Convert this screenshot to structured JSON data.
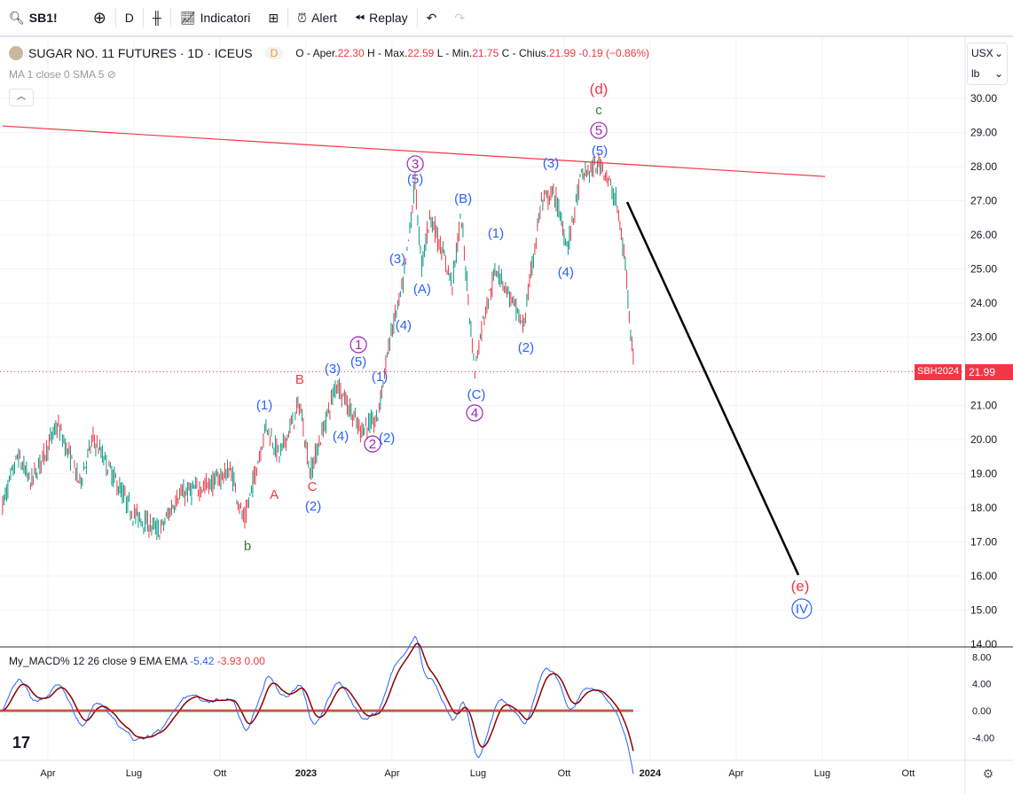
{
  "toolbar": {
    "symbol": "SB1!",
    "interval": "D",
    "indicators": "Indicatori",
    "alert": "Alert",
    "replay": "Replay"
  },
  "legend": {
    "title": "SUGAR NO. 11 FUTURES · 1D · ICEUS",
    "badge": "D",
    "o_label": "O - Aper.",
    "o": "22.30",
    "h_label": "H - Max.",
    "h": "22.59",
    "l_label": "L - Min.",
    "l": "21.75",
    "c_label": "C - Chius.",
    "c": "21.99",
    "chg": "-0.19 (−0.86%)"
  },
  "ma_legend": "MA 1 close 0 SMA 5",
  "macd_legend": {
    "name": "My_MACD% 12 26 close 9 EMA EMA",
    "v1": "-5.42",
    "v2": "-3.93",
    "v3": "0.00"
  },
  "units": {
    "currency": "USX",
    "unit": "lb"
  },
  "price_tag": {
    "symbol": "SBH2024",
    "value": "21.99"
  },
  "colors": {
    "up": "#089981",
    "down": "#f23645",
    "blue": "#2962ff",
    "purple": "#9c27b0",
    "green": "#2e7d32",
    "red": "#f23645"
  },
  "chart_data": {
    "type": "ohlc",
    "x_unit": "months since Jan 2022",
    "ylim": [
      14,
      30
    ],
    "yticks": [
      "30.00",
      "29.00",
      "28.00",
      "27.00",
      "26.00",
      "25.00",
      "24.00",
      "23.00",
      "22.00",
      "21.00",
      "20.00",
      "19.00",
      "18.00",
      "17.00",
      "16.00",
      "15.00",
      "14.00"
    ],
    "xticks": [
      {
        "m": 3,
        "label": "Apr"
      },
      {
        "m": 6,
        "label": "Lug"
      },
      {
        "m": 9,
        "label": "Ott"
      },
      {
        "m": 12,
        "label": "2023"
      },
      {
        "m": 15,
        "label": "Apr"
      },
      {
        "m": 18,
        "label": "Lug"
      },
      {
        "m": 21,
        "label": "Ott"
      },
      {
        "m": 24,
        "label": "2024"
      },
      {
        "m": 27,
        "label": "Apr"
      },
      {
        "m": 30,
        "label": "Lug"
      },
      {
        "m": 33,
        "label": "Ott"
      }
    ],
    "price_path": [
      [
        1.42,
        18.08
      ],
      [
        1.95,
        19.51
      ],
      [
        2.41,
        18.73
      ],
      [
        3.34,
        20.42
      ],
      [
        4.11,
        18.73
      ],
      [
        4.58,
        20.03
      ],
      [
        5.97,
        17.82
      ],
      [
        6.9,
        17.3
      ],
      [
        7.52,
        18.34
      ],
      [
        8.75,
        18.73
      ],
      [
        9.37,
        19.12
      ],
      [
        9.84,
        17.56
      ],
      [
        10.61,
        20.42
      ],
      [
        11.07,
        19.51
      ],
      [
        11.78,
        21.06
      ],
      [
        12.15,
        19.0
      ],
      [
        13.08,
        21.69
      ],
      [
        13.86,
        20.29
      ],
      [
        14.47,
        20.55
      ],
      [
        14.94,
        23.01
      ],
      [
        15.4,
        24.57
      ],
      [
        15.81,
        27.55
      ],
      [
        16.02,
        25.04
      ],
      [
        16.33,
        26.6
      ],
      [
        17.1,
        24.57
      ],
      [
        17.41,
        26.55
      ],
      [
        17.88,
        22.0
      ],
      [
        18.19,
        23.58
      ],
      [
        18.65,
        25.04
      ],
      [
        19.58,
        23.3
      ],
      [
        20.2,
        26.94
      ],
      [
        20.66,
        27.2
      ],
      [
        21.13,
        25.64
      ],
      [
        21.59,
        27.71
      ],
      [
        22.3,
        28.1
      ],
      [
        22.83,
        26.94
      ],
      [
        23.14,
        25.1
      ],
      [
        23.45,
        21.99
      ]
    ],
    "last_price": 21.99,
    "trendline": [
      [
        1.42,
        29.19
      ],
      [
        30.1,
        27.71
      ]
    ],
    "projection": [
      [
        23.2,
        26.96
      ],
      [
        29.17,
        16.03
      ]
    ],
    "macd": {
      "ylim": [
        -5.5,
        8.5
      ],
      "yticks": [
        "8.00",
        "4.00",
        "0.00",
        "-4.00"
      ],
      "tick_values": [
        8,
        4,
        0,
        -4
      ]
    },
    "wave_labels": [
      {
        "t": "(d)",
        "m": 22.21,
        "p": 30.26,
        "c": "red"
      },
      {
        "t": "c",
        "m": 22.21,
        "p": 29.66,
        "c": "green"
      },
      {
        "t": "5",
        "m": 22.21,
        "p": 29.06,
        "c": "purple",
        "circ": true
      },
      {
        "t": "(5)",
        "m": 22.24,
        "p": 28.47,
        "c": "blue"
      },
      {
        "t": "(3)",
        "m": 20.54,
        "p": 28.1,
        "c": "blue"
      },
      {
        "t": "3",
        "m": 15.81,
        "p": 28.08,
        "c": "purple",
        "circ": true
      },
      {
        "t": "(5)",
        "m": 15.81,
        "p": 27.64,
        "c": "blue"
      },
      {
        "t": "(B)",
        "m": 17.48,
        "p": 27.06,
        "c": "blue"
      },
      {
        "t": "(1)",
        "m": 18.62,
        "p": 26.05,
        "c": "blue"
      },
      {
        "t": "(3)",
        "m": 15.19,
        "p": 25.3,
        "c": "blue"
      },
      {
        "t": "(A)",
        "m": 16.05,
        "p": 24.42,
        "c": "blue"
      },
      {
        "t": "(4)",
        "m": 21.06,
        "p": 24.91,
        "c": "blue"
      },
      {
        "t": "(4)",
        "m": 15.4,
        "p": 23.35,
        "c": "blue"
      },
      {
        "t": "(2)",
        "m": 19.67,
        "p": 22.7,
        "c": "blue"
      },
      {
        "t": "1",
        "m": 13.83,
        "p": 22.78,
        "c": "purple",
        "circ": true
      },
      {
        "t": "(5)",
        "m": 13.83,
        "p": 22.29,
        "c": "blue"
      },
      {
        "t": "(3)",
        "m": 12.93,
        "p": 22.08,
        "c": "blue"
      },
      {
        "t": "(1)",
        "m": 14.57,
        "p": 21.84,
        "c": "blue"
      },
      {
        "t": "B",
        "m": 11.78,
        "p": 21.77,
        "c": "red"
      },
      {
        "t": "(C)",
        "m": 17.94,
        "p": 21.32,
        "c": "blue"
      },
      {
        "t": "4",
        "m": 17.88,
        "p": 20.78,
        "c": "purple",
        "circ": true
      },
      {
        "t": "(1)",
        "m": 10.55,
        "p": 21.01,
        "c": "blue"
      },
      {
        "t": "(4)",
        "m": 13.21,
        "p": 20.1,
        "c": "blue"
      },
      {
        "t": "2",
        "m": 14.32,
        "p": 19.87,
        "c": "purple",
        "circ": true
      },
      {
        "t": "(2)",
        "m": 14.82,
        "p": 20.05,
        "c": "blue"
      },
      {
        "t": "C",
        "m": 12.22,
        "p": 18.62,
        "c": "red"
      },
      {
        "t": "A",
        "m": 10.89,
        "p": 18.39,
        "c": "red"
      },
      {
        "t": "(2)",
        "m": 12.25,
        "p": 18.05,
        "c": "blue"
      },
      {
        "t": "b",
        "m": 9.96,
        "p": 16.88,
        "c": "green"
      },
      {
        "t": "(e)",
        "m": 29.23,
        "p": 15.69,
        "c": "red"
      },
      {
        "t": "IV",
        "m": 29.29,
        "p": 15.04,
        "c": "blue",
        "circ": true
      }
    ]
  }
}
